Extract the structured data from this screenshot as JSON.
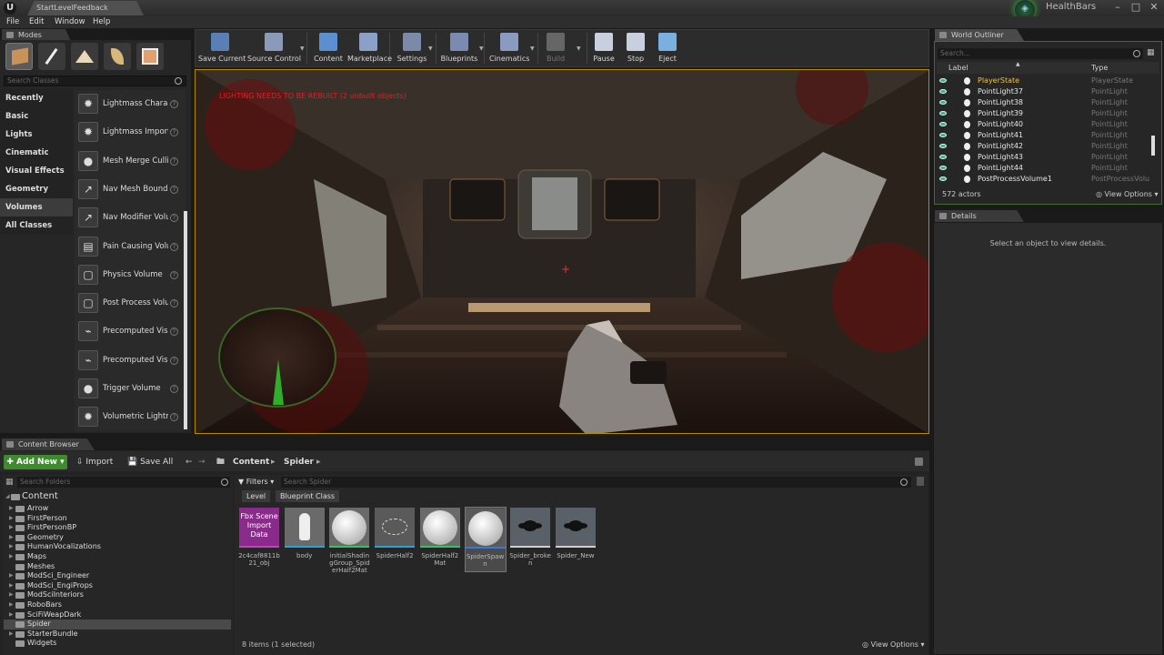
{
  "window": {
    "app_logo": "U",
    "doc_tab": "StartLevelFeedback",
    "project_name": "HealthBars",
    "controls": [
      "–",
      "□",
      "✕"
    ]
  },
  "menu": [
    "File",
    "Edit",
    "Window",
    "Help"
  ],
  "modes": {
    "tab": "Modes",
    "search_placeholder": "Search Classes",
    "icons": [
      "place-mode-icon",
      "paint-mode-icon",
      "landscape-mode-icon",
      "foliage-mode-icon",
      "geometry-edit-mode-icon"
    ],
    "categories": [
      "Recently Placed",
      "Basic",
      "Lights",
      "Cinematic",
      "Visual Effects",
      "Geometry",
      "Volumes",
      "All Classes"
    ],
    "selected_category": "Volumes",
    "classes": [
      {
        "label": "Lightmass Charac",
        "icon": "✹"
      },
      {
        "label": "Lightmass Importa",
        "icon": "✹"
      },
      {
        "label": "Mesh Merge Culling V",
        "icon": "●"
      },
      {
        "label": "Nav Mesh Bounds",
        "icon": "↗"
      },
      {
        "label": "Nav Modifier Volu",
        "icon": "↗"
      },
      {
        "label": "Pain Causing Volu",
        "icon": "▤"
      },
      {
        "label": "Physics Volume",
        "icon": "▢"
      },
      {
        "label": "Post Process Volu",
        "icon": "▢"
      },
      {
        "label": "Precomputed Visil",
        "icon": "⌁"
      },
      {
        "label": "Precomputed Visil",
        "icon": "⌁"
      },
      {
        "label": "Trigger Volume",
        "icon": "●"
      },
      {
        "label": "Volumetric Lightmap I",
        "icon": "✹"
      }
    ]
  },
  "toolbar": [
    {
      "label": "Save Current",
      "icon": "save-icon",
      "color": "#5a7fb5"
    },
    {
      "label": "Source Control",
      "icon": "source-control-icon",
      "color": "#8a9ab8"
    },
    {
      "label": "Content",
      "icon": "content-icon",
      "color": "#5b8fd0"
    },
    {
      "label": "Marketplace",
      "icon": "marketplace-icon",
      "color": "#8aa0c8"
    },
    {
      "label": "Settings",
      "icon": "settings-icon",
      "color": "#7a8aa8"
    },
    {
      "label": "Blueprints",
      "icon": "blueprints-icon",
      "color": "#7a8ab0"
    },
    {
      "label": "Cinematics",
      "icon": "cinematics-icon",
      "color": "#8a9ac0"
    },
    {
      "label": "Build",
      "icon": "build-icon",
      "color": "#666666"
    },
    {
      "label": "Pause",
      "icon": "pause-icon",
      "color": "#c8d0e0"
    },
    {
      "label": "Stop",
      "icon": "stop-icon",
      "color": "#c8d0e0"
    },
    {
      "label": "Eject",
      "icon": "eject-icon",
      "color": "#7ab0e0"
    }
  ],
  "viewport": {
    "warning": "LIGHTING NEEDS TO BE REBUILT (2 unbuilt objects)",
    "crosshair": "+",
    "accent": "#b58a00"
  },
  "outliner": {
    "tab": "World Outliner",
    "search_placeholder": "Search...",
    "col_label": "Label",
    "col_type": "Type",
    "rows": [
      {
        "label": "PlayerState",
        "type": "PlayerState"
      },
      {
        "label": "PointLight37",
        "type": "PointLight"
      },
      {
        "label": "PointLight38",
        "type": "PointLight"
      },
      {
        "label": "PointLight39",
        "type": "PointLight"
      },
      {
        "label": "PointLight40",
        "type": "PointLight"
      },
      {
        "label": "PointLight41",
        "type": "PointLight"
      },
      {
        "label": "PointLight42",
        "type": "PointLight"
      },
      {
        "label": "PointLight43",
        "type": "PointLight"
      },
      {
        "label": "PointLight44",
        "type": "PointLight"
      },
      {
        "label": "PostProcessVolume1",
        "type": "PostProcessVolu"
      }
    ],
    "actor_count": "572 actors",
    "view_options": "View Options"
  },
  "details": {
    "tab": "Details",
    "message": "Select an object to view details."
  },
  "content_browser": {
    "tab": "Content Browser",
    "add_new": "Add New",
    "import": "Import",
    "save_all": "Save All",
    "breadcrumb": [
      "Content",
      "Spider"
    ],
    "folder_search": "Search Folders",
    "filters": "Filters",
    "asset_search": "Search Spider",
    "chips": [
      "Level",
      "Blueprint Class"
    ],
    "root": "Content",
    "folders": [
      "Arrow",
      "FirstPerson",
      "FirstPersonBP",
      "Geometry",
      "HumanVocalizations",
      "Maps",
      "Meshes",
      "ModSci_Engineer",
      "ModSci_EngiProps",
      "ModSciInteriors",
      "RoboBars",
      "SciFiWeapDark",
      "Spider",
      "StarterBundle",
      "Widgets"
    ],
    "selected_folder": "Spider",
    "assets": [
      {
        "thumb_text": "Fbx Scene Import Data",
        "name": "2c4caf8811b21_obj",
        "bg": "#8a2a8a",
        "bar": "#c040c0"
      },
      {
        "thumb_text": "",
        "name": "body",
        "bg": "#6a6a6a",
        "bar": "#2fa0d0"
      },
      {
        "thumb_text": "",
        "name": "initialShadingGroup_SpiderHalf2Mat",
        "bg": "#6a6a6a",
        "bar": "#3ac060"
      },
      {
        "thumb_text": "",
        "name": "SpiderHalf2",
        "bg": "#5a5a5a",
        "bar": "#2fa0d0"
      },
      {
        "thumb_text": "",
        "name": "SpiderHalf2Mat",
        "bg": "#6a6a6a",
        "bar": "#3ac060"
      },
      {
        "thumb_text": "",
        "name": "SpiderSpawn",
        "bg": "#5a5a5a",
        "bar": "#3a78d8"
      },
      {
        "thumb_text": "",
        "name": "Spider_broken",
        "bg": "#5a6068",
        "bar": "#d0d0d0"
      },
      {
        "thumb_text": "",
        "name": "Spider_New",
        "bg": "#5a6068",
        "bar": "#d0d0d0"
      }
    ],
    "selected_asset": "SpiderSpawn",
    "item_count": "8 items (1 selected)",
    "view_options": "View Options"
  }
}
